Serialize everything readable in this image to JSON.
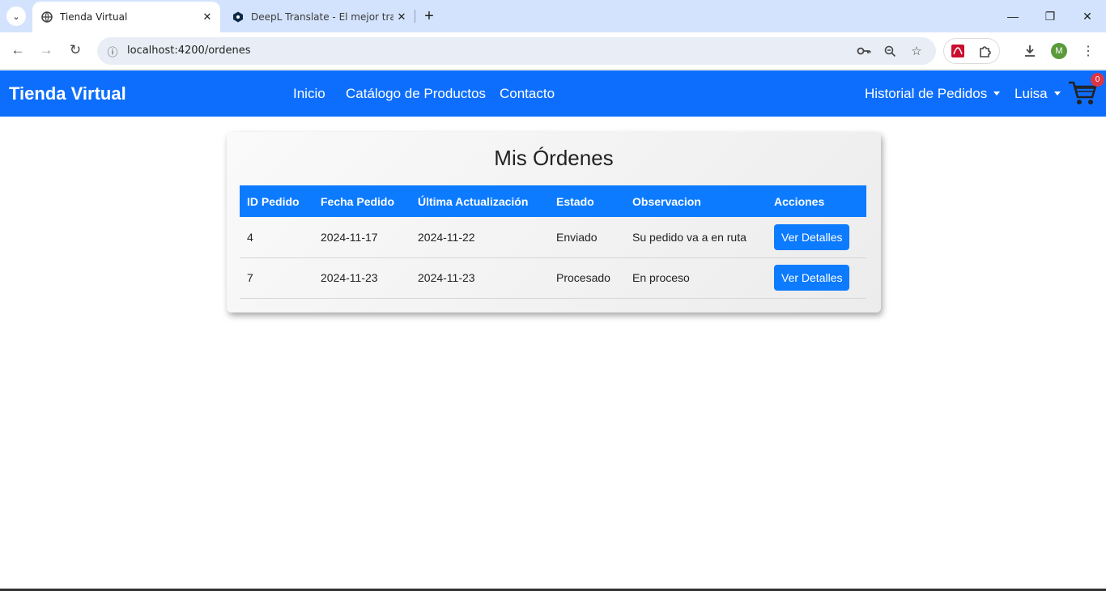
{
  "browser": {
    "tabs": [
      {
        "title": "Tienda Virtual",
        "active": true
      },
      {
        "title": "DeepL Translate - El mejor tradu",
        "active": false
      }
    ],
    "url": "localhost:4200/ordenes",
    "profile_initial": "M"
  },
  "navbar": {
    "brand": "Tienda Virtual",
    "links": [
      "Inicio",
      "Catálogo de Productos",
      "Contacto"
    ],
    "orders_menu": "Historial de Pedidos",
    "user_menu": "Luisa",
    "cart_count": "0"
  },
  "orders": {
    "title": "Mis Órdenes",
    "columns": [
      "ID Pedido",
      "Fecha Pedido",
      "Última Actualización",
      "Estado",
      "Observacion",
      "Acciones"
    ],
    "rows": [
      {
        "id": "4",
        "date": "2024-11-17",
        "updated": "2024-11-22",
        "status": "Enviado",
        "note": "Su pedido va a en ruta",
        "action": "Ver Detalles"
      },
      {
        "id": "7",
        "date": "2024-11-23",
        "updated": "2024-11-23",
        "status": "Procesado",
        "note": "En proceso",
        "action": "Ver Detalles"
      }
    ]
  },
  "colors": {
    "primary": "#0d6efd",
    "table_header": "#0d7bff",
    "badge": "#dc3545"
  }
}
